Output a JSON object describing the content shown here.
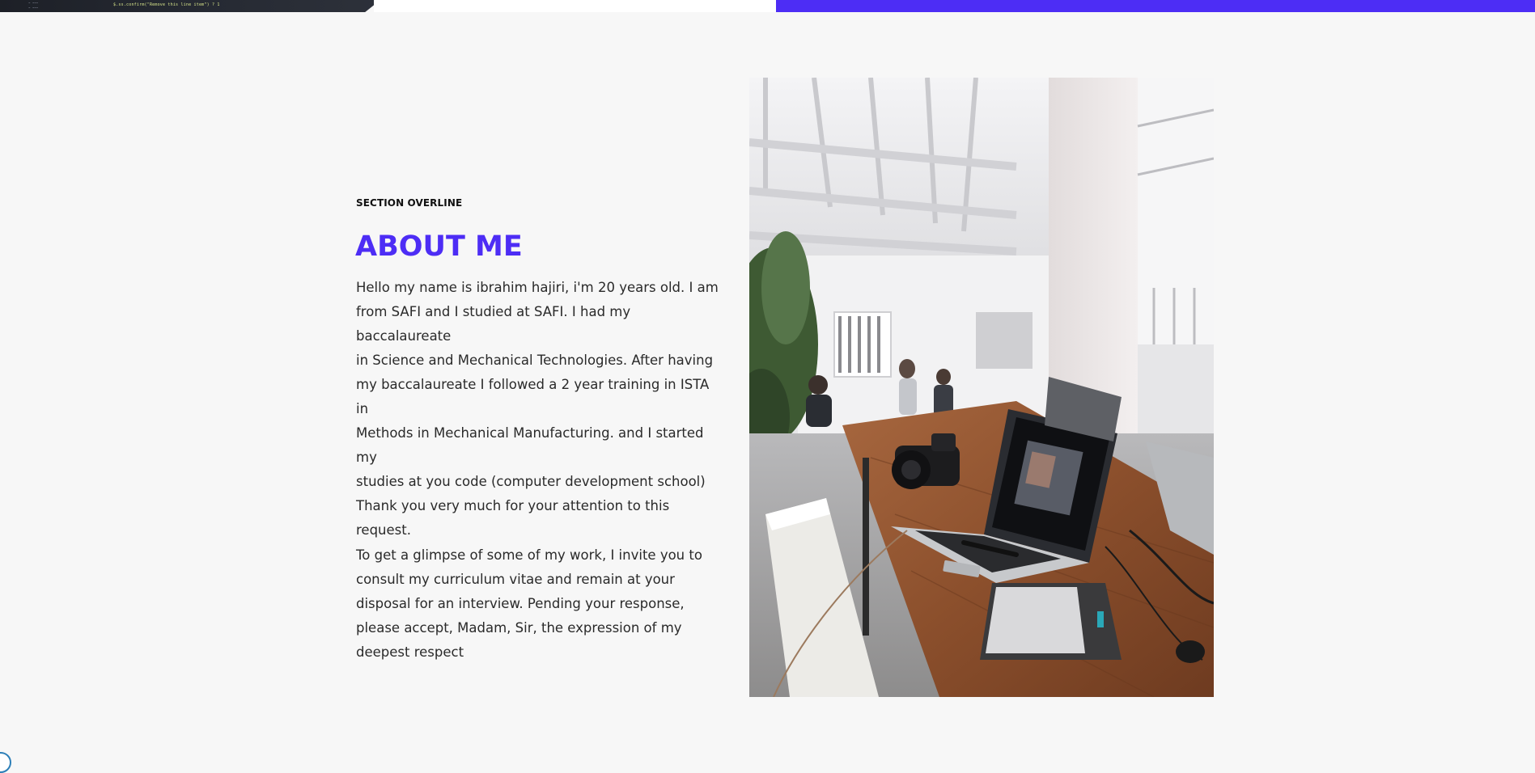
{
  "top_strip": {
    "code_line": "$.ss.confirm(\"Remove this line item\") ? 1"
  },
  "about": {
    "overline": "SECTION OVERLINE",
    "title": "ABOUT ME",
    "bio": "Hello  my name is ibrahim hajiri, i'm 20 years old. I am\nfrom SAFI and I studied at SAFI. I had my baccalaureate\nin Science and Mechanical Technologies. After having\nmy baccalaureate I followed a 2 year training in ISTA in\nMethods in Mechanical Manufacturing. and I started my\nstudies at you code (computer development school)\nThank you very much for your attention to this request.\nTo get a glimpse of some of my work, I invite you to\nconsult my curriculum vitae and remain at your\ndisposal for an interview.  Pending your response,\nplease accept, Madam, Sir, the expression of my\ndeepest respect"
  },
  "colors": {
    "accent": "#4d2df5",
    "background": "#f7f7f7",
    "text": "#2a2a2a"
  },
  "photo": {
    "subject": "workspace-laptop-camera-photo"
  }
}
